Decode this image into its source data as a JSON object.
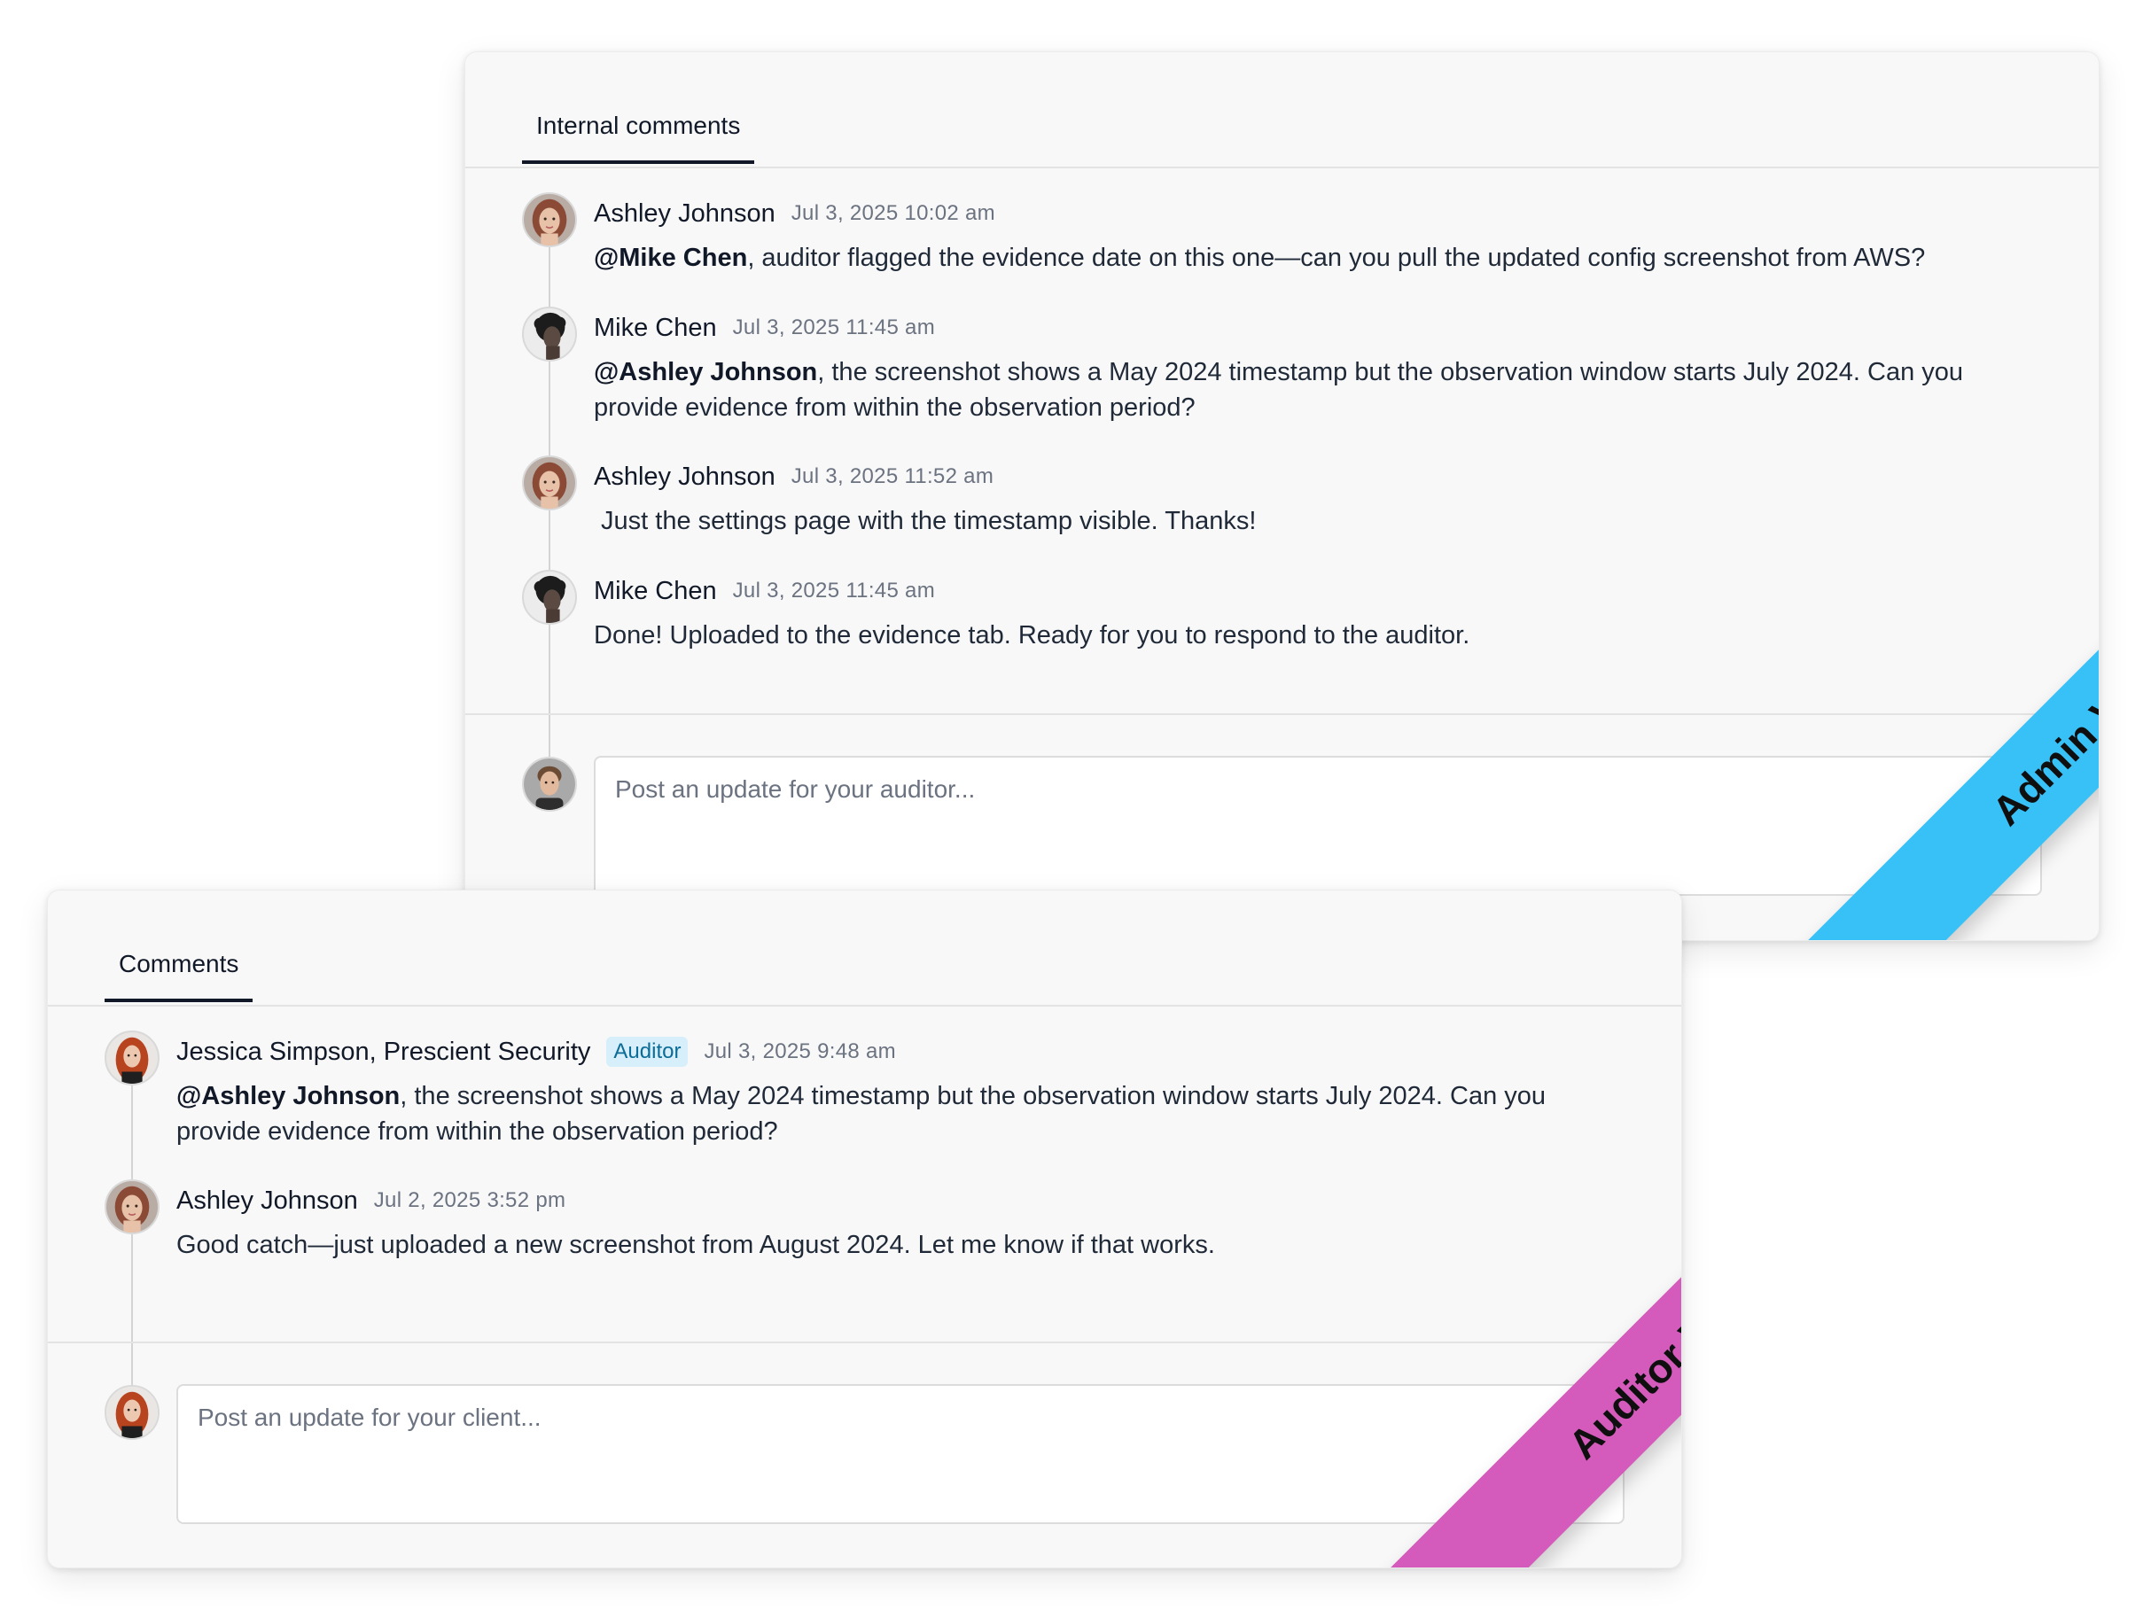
{
  "admin_panel": {
    "tab_label": "Internal comments",
    "ribbon_label": "Admin View",
    "ribbon_color": "#38c1f7",
    "comments": [
      {
        "author": "Ashley Johnson",
        "time": "Jul 3, 2025 10:02 am",
        "mention": "@Mike Chen",
        "text": ", auditor flagged the evidence date on this one—can you pull the updated config screenshot from AWS?",
        "avatar": "woman-auburn-hair-avatar"
      },
      {
        "author": "Mike Chen",
        "time": "Jul 3, 2025 11:45 am",
        "mention": "@Ashley Johnson",
        "text": ", the screenshot shows a May 2024 timestamp but the observation window starts July 2024. Can you provide evidence from within the observation period?",
        "avatar": "man-curly-hair-avatar"
      },
      {
        "author": "Ashley Johnson",
        "time": "Jul 3, 2025 11:52 am",
        "mention": "",
        "text": " Just the settings page with the timestamp visible. Thanks!",
        "avatar": "woman-auburn-hair-avatar"
      },
      {
        "author": "Mike Chen",
        "time": "Jul 3, 2025 11:45 am",
        "mention": "",
        "text": "Done! Uploaded to the evidence tab. Ready for you to respond to the auditor.",
        "avatar": "man-curly-hair-avatar"
      }
    ],
    "composer": {
      "placeholder": "Post an update for your auditor...",
      "avatar": "man-short-hair-avatar"
    }
  },
  "auditor_panel": {
    "tab_label": "Comments",
    "ribbon_label": "Auditor View",
    "ribbon_color": "#d45bbb",
    "comments": [
      {
        "author": "Jessica Simpson, Prescient Security",
        "badge": "Auditor",
        "time": "Jul 3, 2025 9:48 am",
        "mention": "@Ashley Johnson",
        "text": ", the screenshot shows a May 2024 timestamp but the observation window starts July 2024. Can you provide evidence from within the observation period?",
        "avatar": "woman-red-hair-avatar"
      },
      {
        "author": "Ashley Johnson",
        "time": "Jul 2, 2025 3:52 pm",
        "mention": "",
        "text": "Good catch—just uploaded a new screenshot from August 2024. Let me know if that works.",
        "avatar": "woman-auburn-hair-avatar"
      }
    ],
    "composer": {
      "placeholder": "Post an update for your client...",
      "avatar": "woman-red-hair-avatar"
    }
  }
}
